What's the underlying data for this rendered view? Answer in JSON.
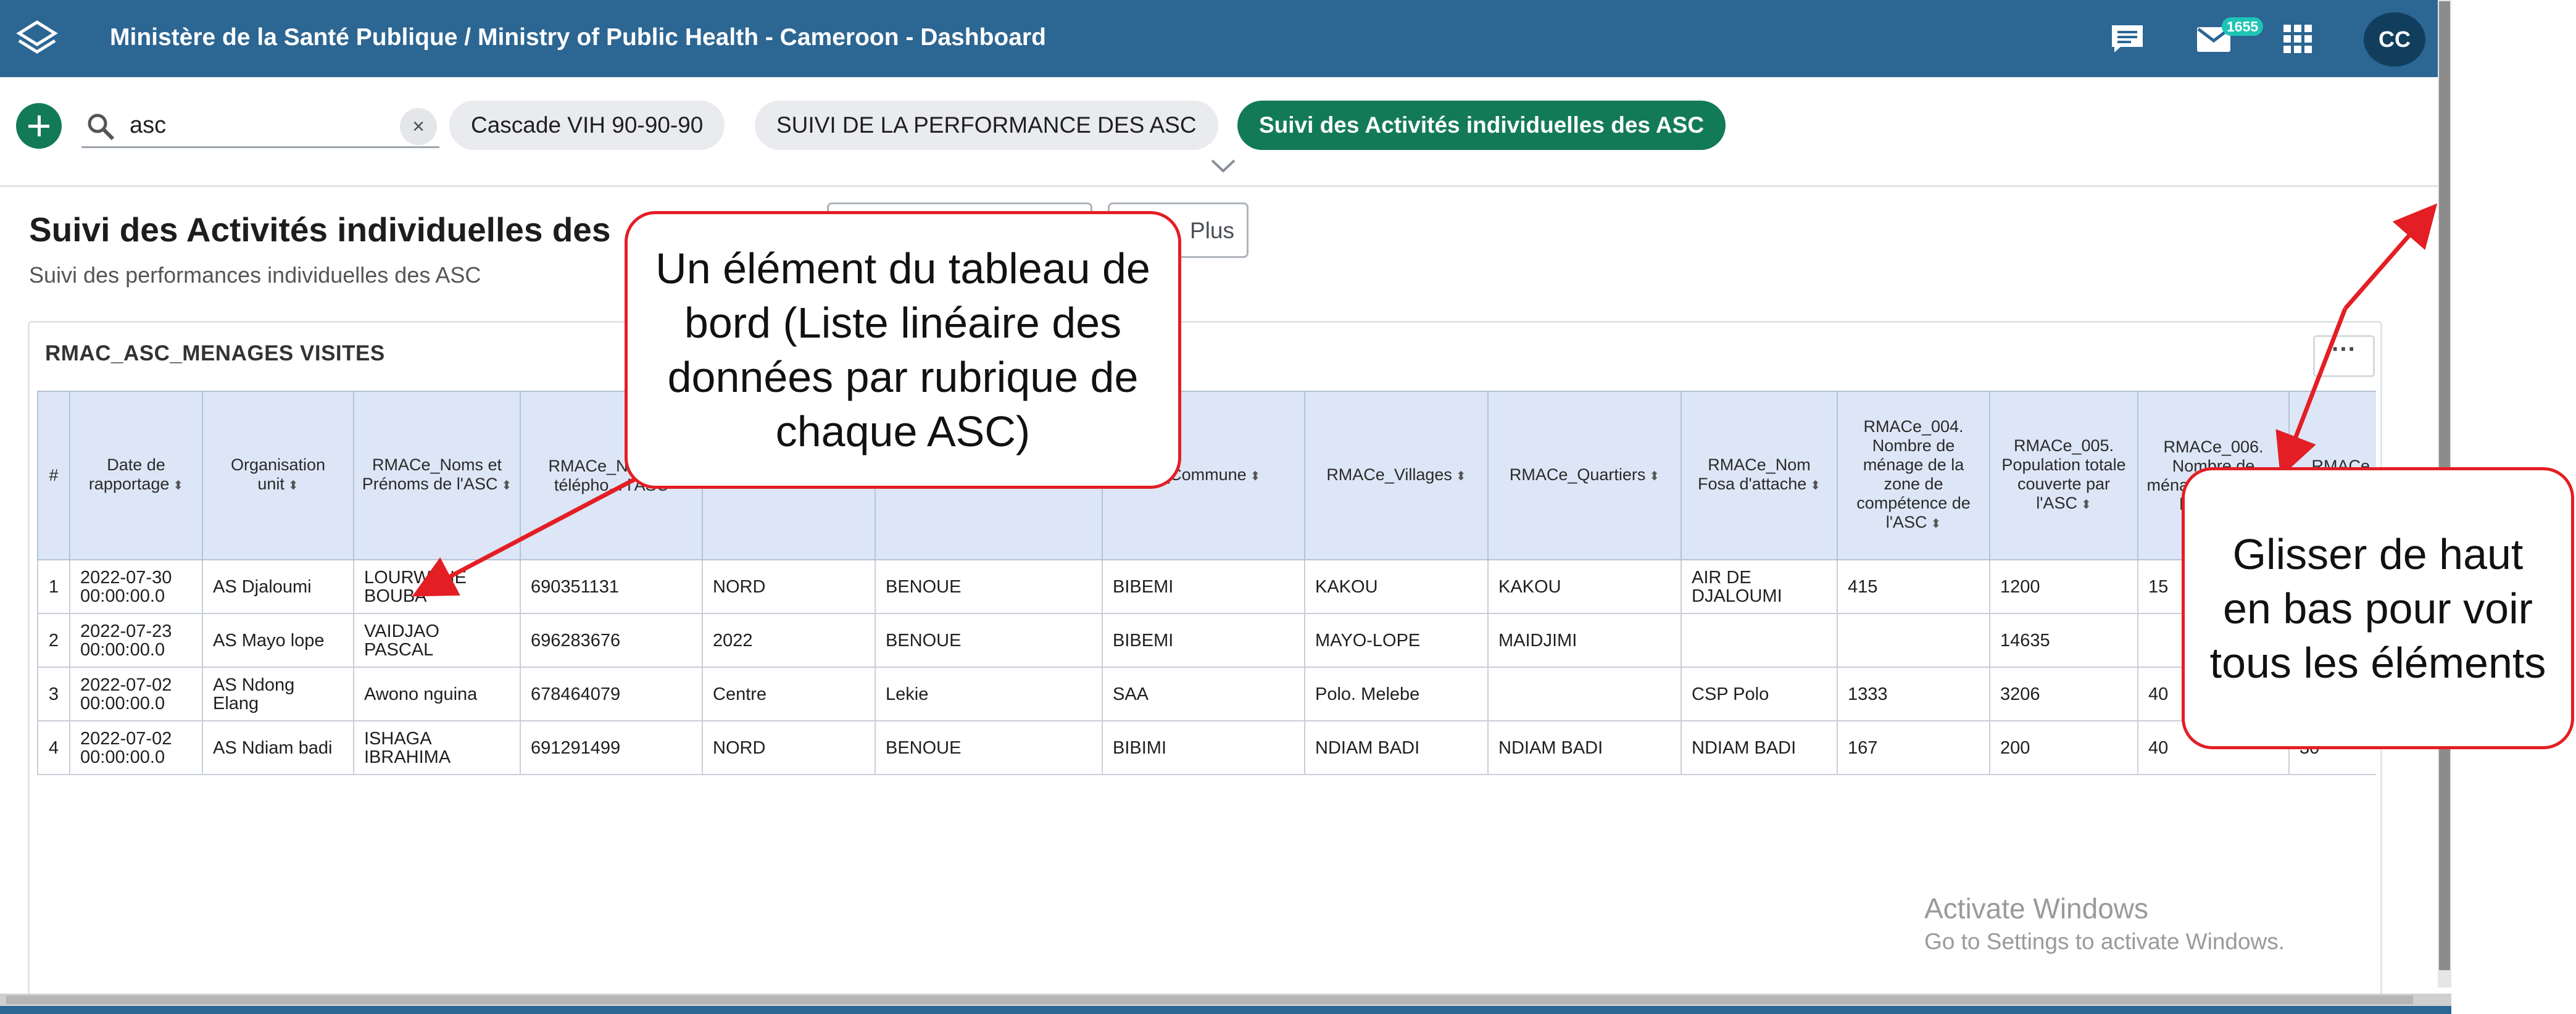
{
  "header": {
    "title": "Ministère de la Santé Publique / Ministry of Public Health - Cameroon - Dashboard",
    "logo_icon": "dhis2-logo-icon",
    "interpretations_icon": "chat-icon",
    "messages_icon": "mail-icon",
    "messages_count": "1655",
    "apps_icon": "grid-icon",
    "user_initials": "CC",
    "bar_color": "#2c6693"
  },
  "toolbar": {
    "add_icon": "plus-icon",
    "search_value": "asc",
    "clear_label": "×",
    "dashboards": [
      {
        "label": "Cascade VIH 90-90-90",
        "active": false
      },
      {
        "label": "SUIVI DE LA PERFORMANCE DES ASC",
        "active": false
      },
      {
        "label": "Suivi des Activités individuelles des ASC",
        "active": true
      }
    ],
    "active_color": "#137a58"
  },
  "dashboard": {
    "title": "Suivi des Activités individuelles des",
    "description": "Suivi des performances individuelles des ASC",
    "button_more": "Plus"
  },
  "item": {
    "title": "RMAC_ASC_MENAGES VISITES",
    "menu_label": "···",
    "columns": [
      "#",
      "Date de rapportage",
      "Organisation unit",
      "RMACe_Noms et Prénoms de l'ASC",
      "RMACe_Nu... de télépho... l'ASC",
      "",
      "",
      "..._Commune",
      "RMACe_Villages",
      "RMACe_Quartiers",
      "RMACe_Nom Fosa d'attache",
      "RMACe_004. Nombre de ménage de la zone de compétence de l'ASC",
      "RMACe_005. Population totale couverte par l'ASC",
      "RMACe_006. Nombre de ménages visités... l'A... co...",
      "RMACe_0... Nombre..."
    ],
    "rows": [
      [
        "1",
        "2022-07-30 00:00:00.0",
        "AS Djaloumi",
        "LOURWANE BOUBA",
        "690351131",
        "NORD",
        "BENOUE",
        "BIBEMI",
        "KAKOU",
        "KAKOU",
        "AIR DE DJALOUMI",
        "415",
        "1200",
        "15",
        ""
      ],
      [
        "2",
        "2022-07-23 00:00:00.0",
        "AS Mayo lope",
        "VAIDJAO PASCAL",
        "696283676",
        "2022",
        "BENOUE",
        "BIBEMI",
        "MAYO-LOPE",
        "MAIDJIMI",
        "",
        "",
        "14635",
        "",
        ""
      ],
      [
        "3",
        "2022-07-02 00:00:00.0",
        "AS Ndong Elang",
        "Awono nguina",
        "678464079",
        "Centre",
        "Lekie",
        "SAA",
        "Polo. Melebe",
        "",
        "CSP Polo",
        "1333",
        "3206",
        "40",
        ""
      ],
      [
        "4",
        "2022-07-02 00:00:00.0",
        "AS Ndiam badi",
        "ISHAGA IBRAHIMA",
        "691291499",
        "NORD",
        "BENOUE",
        "BIBIMI",
        "NDIAM BADI",
        "NDIAM BADI",
        "NDIAM BADI",
        "167",
        "200",
        "40",
        "30"
      ]
    ]
  },
  "watermark": {
    "line1": "Activate Windows",
    "line2": "Go to Settings to activate Windows."
  },
  "annotations": {
    "callout1": "Un élément du tableau de bord (Liste linéaire des données par rubrique de chaque ASC)",
    "callout2": "Glisser de haut en bas pour voir tous les éléments",
    "color": "#e31e24"
  }
}
